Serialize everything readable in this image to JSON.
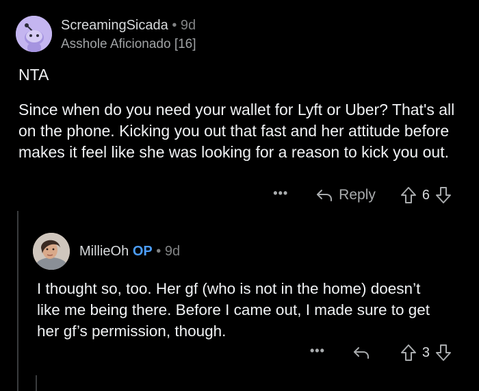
{
  "comments": [
    {
      "username": "ScreamingSicada",
      "separator": "•",
      "time": "9d",
      "flair": "Asshole Aficionado [16]",
      "verdict": "NTA",
      "body": "Since when do you need your wallet for Lyft or Uber? That's all on the phone. Kicking you out that fast and her attitude before makes it feel like she was looking for a reason to kick you out.",
      "more": "•••",
      "reply_label": "Reply",
      "score": "6"
    },
    {
      "username": "MillieOh",
      "op_badge": "OP",
      "separator": "•",
      "time": "9d",
      "body": "I thought so, too. Her gf (who is not in the home) doesn’t like me being there. Before I came out, I made sure to get her gf’s permission, though.",
      "more": "•••",
      "score": "3"
    }
  ],
  "icons": {
    "avatar1": "reddit-snoo-avatar",
    "avatar2": "user-photo-avatar",
    "reply": "reply-arrow-icon",
    "upvote": "upvote-arrow-icon",
    "downvote": "downvote-arrow-icon"
  },
  "colors": {
    "background": "#000000",
    "text": "#f0f2f4",
    "meta": "#818384",
    "op": "#4c9df8",
    "avatar1_bg": "#c4b5f0"
  }
}
